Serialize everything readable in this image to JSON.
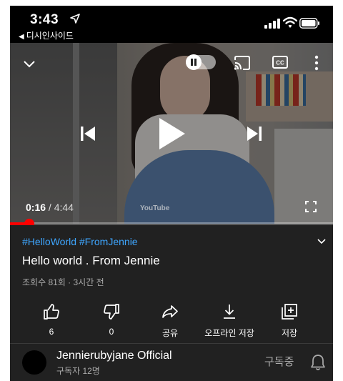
{
  "status_bar": {
    "time": "3:43",
    "back_app": "디시인사이드"
  },
  "player": {
    "current_time": "0:16",
    "duration": "4:44",
    "progress_fraction": 0.06,
    "watermark": "YouTube",
    "accent_color": "#ff0000"
  },
  "video": {
    "hashtags": "#HelloWorld #FromJennie",
    "title": "Hello world . From Jennie",
    "meta": "조회수 81회 · 3시간 전",
    "hashtag_color": "#3ea6ff"
  },
  "actions": [
    {
      "icon": "thumbs-up-icon",
      "label": "6"
    },
    {
      "icon": "thumbs-down-icon",
      "label": "0"
    },
    {
      "icon": "share-icon",
      "label": "공유"
    },
    {
      "icon": "download-icon",
      "label": "오프라인 저장"
    },
    {
      "icon": "save-playlist-icon",
      "label": "저장"
    }
  ],
  "channel": {
    "name": "Jennierubyjane Official",
    "subscribers": "구독자 12명",
    "subscribed_label": "구독중"
  }
}
